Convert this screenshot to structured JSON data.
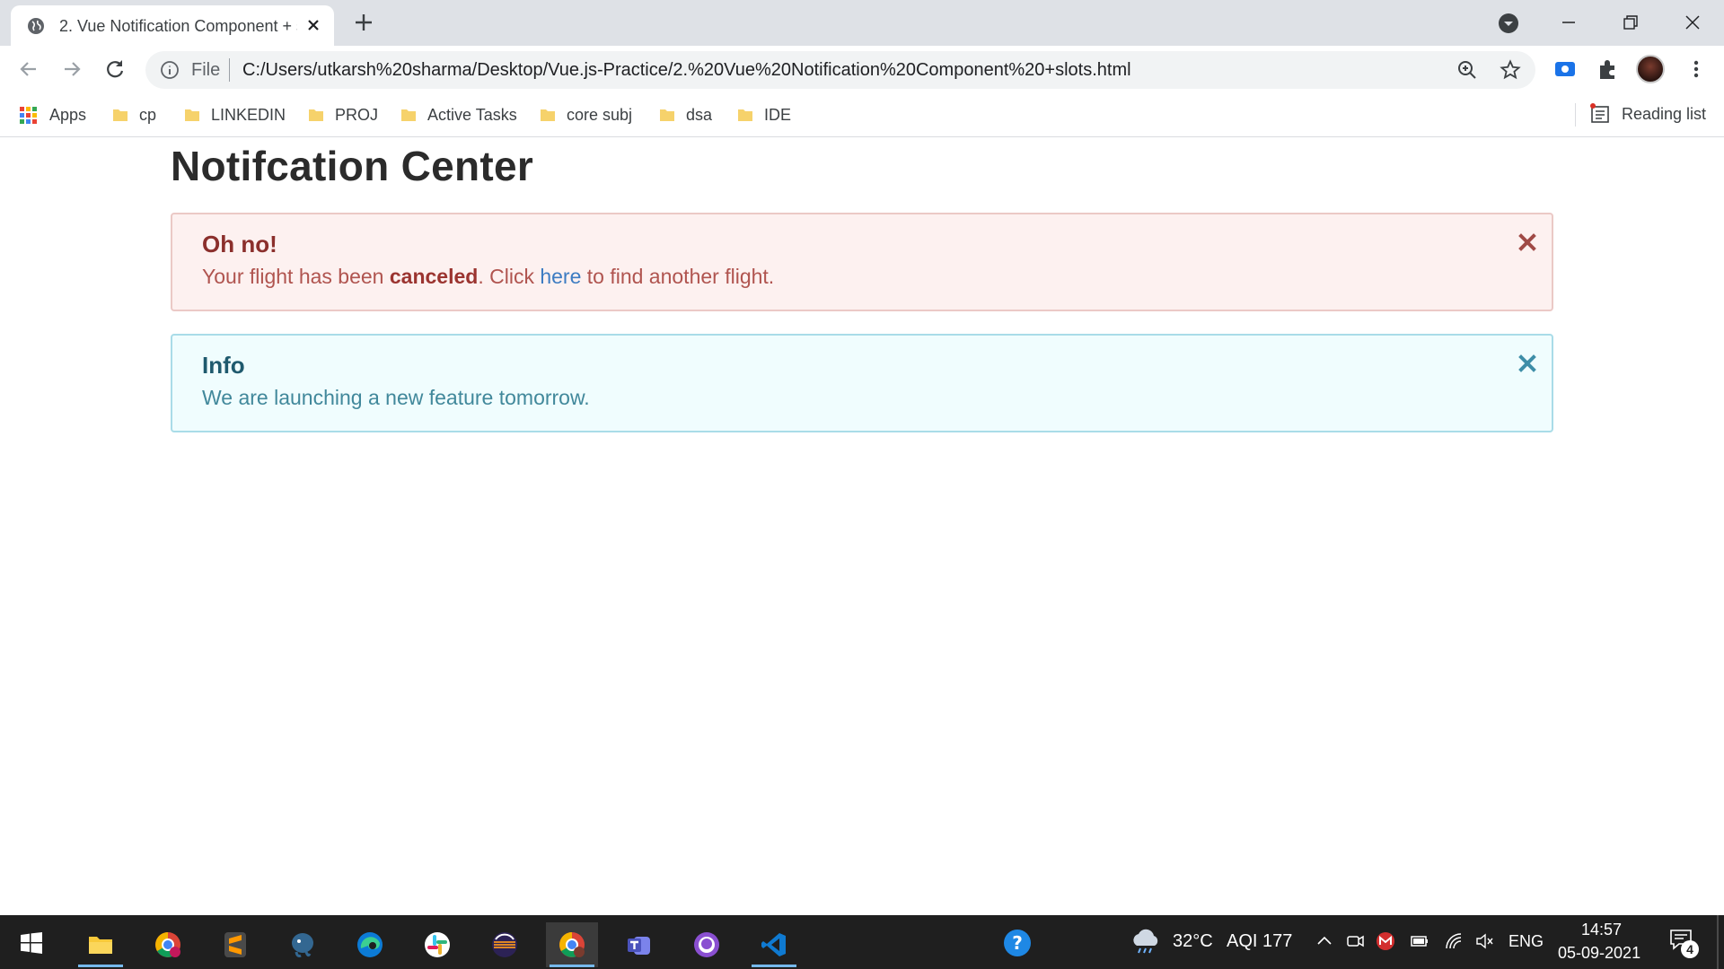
{
  "browser": {
    "tab": {
      "title": "2. Vue Notification Component + slots"
    },
    "omnibox": {
      "scheme": "File",
      "url": "C:/Users/utkarsh%20sharma/Desktop/Vue.js-Practice/2.%20Vue%20Notification%20Component%20+slots.html"
    },
    "bookmarks": [
      {
        "label": "Apps"
      },
      {
        "label": "cp"
      },
      {
        "label": "LINKEDIN"
      },
      {
        "label": "PROJ"
      },
      {
        "label": "Active Tasks"
      },
      {
        "label": "core subj"
      },
      {
        "label": "dsa"
      },
      {
        "label": "IDE"
      }
    ],
    "reading_list": "Reading list"
  },
  "page": {
    "title": "Notifcation Center",
    "alerts": [
      {
        "type": "danger",
        "title": "Oh no!",
        "body_prefix": "Your flight has been ",
        "body_bold": "canceled",
        "body_mid": ". Click ",
        "body_link": "here",
        "body_suffix": " to find another flight."
      },
      {
        "type": "info",
        "title": "Info",
        "body": "We are launching a new feature tomorrow."
      }
    ]
  },
  "taskbar": {
    "weather": "32°C",
    "aqi": "AQI 177",
    "language": "ENG",
    "time": "14:57",
    "date": "05-09-2021",
    "notification_count": "4"
  },
  "colors": {
    "danger_bg": "#fdf1f0",
    "danger_title": "#8b2f2c",
    "info_bg": "#f0fdfe",
    "info_title": "#1f5a6e",
    "link": "#3d7cc2"
  }
}
